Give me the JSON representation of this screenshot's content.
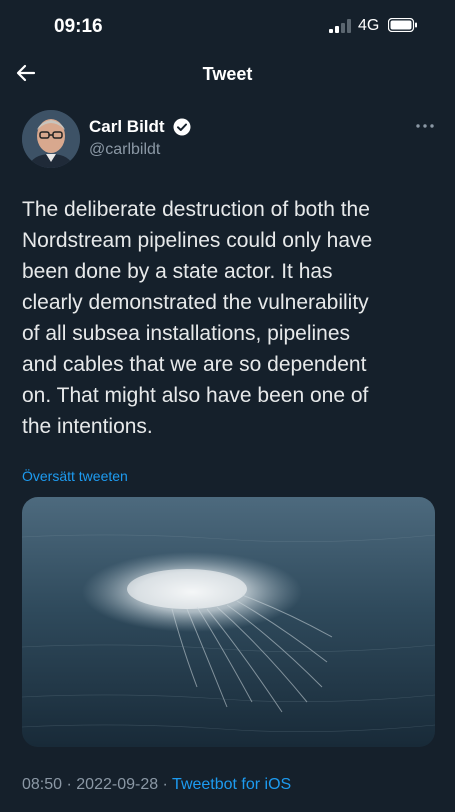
{
  "status": {
    "time": "09:16",
    "network": "4G"
  },
  "nav": {
    "title": "Tweet"
  },
  "tweet": {
    "author_name": "Carl Bildt",
    "handle": "@carlbildt",
    "lines": [
      "The deliberate destruction of both the",
      "Nordstream pipelines could only have",
      "been done by a state actor. It has",
      "clearly demonstrated the vulnerability",
      "of all subsea installations, pipelines",
      "and cables that we are so dependent",
      "on. That might also have been one of",
      "the intentions."
    ],
    "translate_label": "Översätt tweeten",
    "time": "08:50",
    "sep1": " · ",
    "date": "2022-09-28",
    "sep2": " · ",
    "source": "Tweetbot for iOS"
  },
  "colors": {
    "background": "#15202b",
    "accent": "#1d9bf0",
    "secondary_text": "#8b98a5"
  },
  "icons": [
    "back-arrow-icon",
    "verified-badge-icon",
    "more-options-icon",
    "signal-icon",
    "battery-icon"
  ]
}
